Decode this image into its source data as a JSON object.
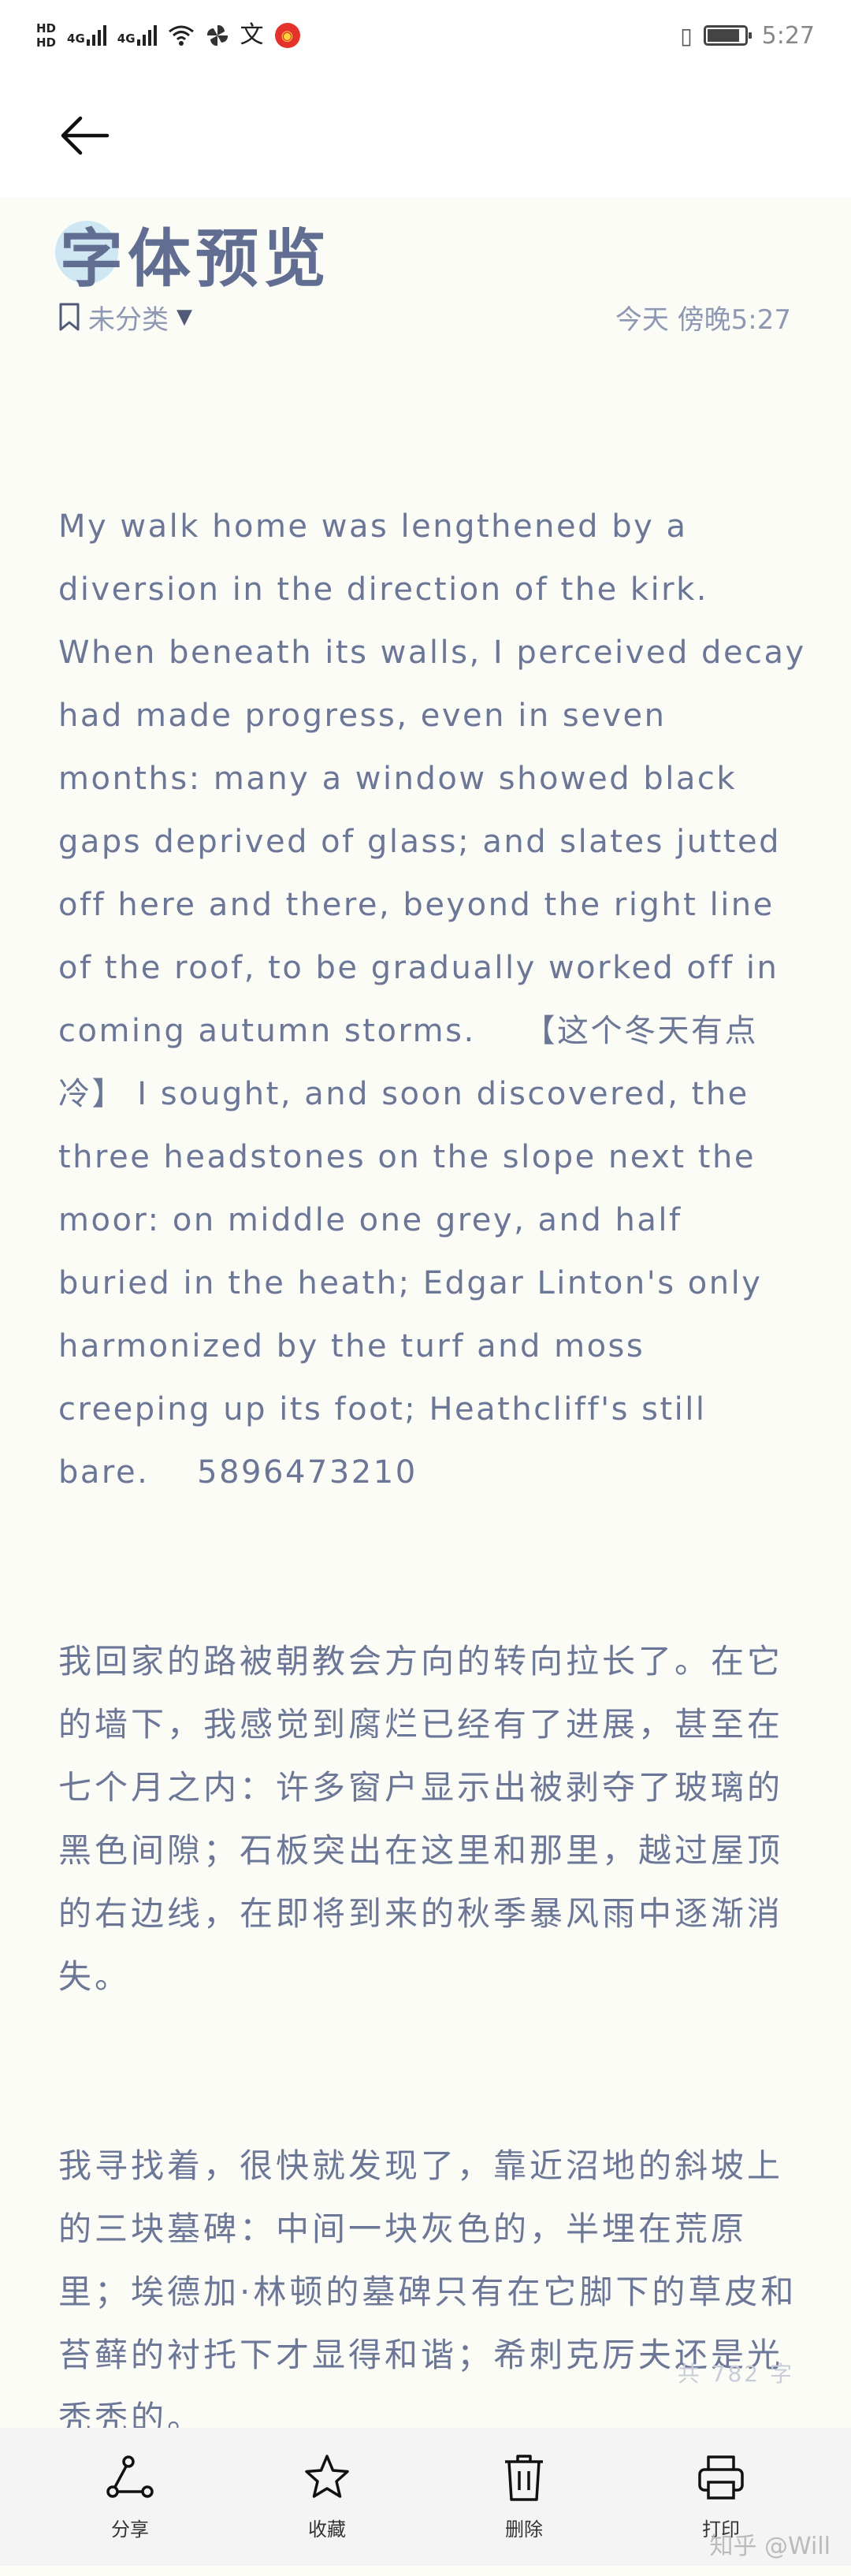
{
  "status_bar": {
    "hd_top": "HD",
    "hd_bottom": "HD",
    "net_1": "4G",
    "net_2": "4G",
    "extra_glyph": "文",
    "time": "5:27"
  },
  "header": {
    "title": "字体预览"
  },
  "meta": {
    "category": "未分类",
    "date_time": "今天 傍晚5:27"
  },
  "body": {
    "english_paragraph": "My walk home was lengthened by a diversion in the direction of the kirk. When beneath its walls, I perceived decay had made progress, even in seven months: many a window showed black gaps deprived of glass; and slates jutted off here and there, beyond the right line of the roof, to be gradually worked off in coming autumn storms.    【这个冬天有点冷】 I sought, and soon discovered, the three headstones on the slope next the moor: on middle one grey, and half buried in the heath; Edgar Linton's only harmonized by the turf and moss creeping up its foot; Heathcliff's still bare.    5896473210",
    "chinese_paragraph_1": "我回家的路被朝教会方向的转向拉长了。在它的墙下，我感觉到腐烂已经有了进展，甚至在七个月之内：许多窗户显示出被剥夺了玻璃的黑色间隙；石板突出在这里和那里，越过屋顶的右边线，在即将到来的秋季暴风雨中逐渐消失。",
    "chinese_paragraph_2": "我寻找着，很快就发现了，靠近沼地的斜坡上的三块墓碑：中间一块灰色的，半埋在荒原里；埃德加·林顿的墓碑只有在它脚下的草皮和苔藓的衬托下才显得和谐；希刺克厉夫还是光秃秃的。"
  },
  "footer": {
    "word_count": "共 782 字",
    "actions": [
      {
        "label": "分享",
        "icon": "share-icon"
      },
      {
        "label": "收藏",
        "icon": "star-icon"
      },
      {
        "label": "删除",
        "icon": "trash-icon"
      },
      {
        "label": "打印",
        "icon": "printer-icon"
      }
    ],
    "watermark": "知乎 @Will"
  },
  "colors": {
    "text": "#6c7697",
    "accent_blue": "#aad6f0",
    "accent_yellow": "#ffd68c",
    "background": "#fbfcf6"
  }
}
